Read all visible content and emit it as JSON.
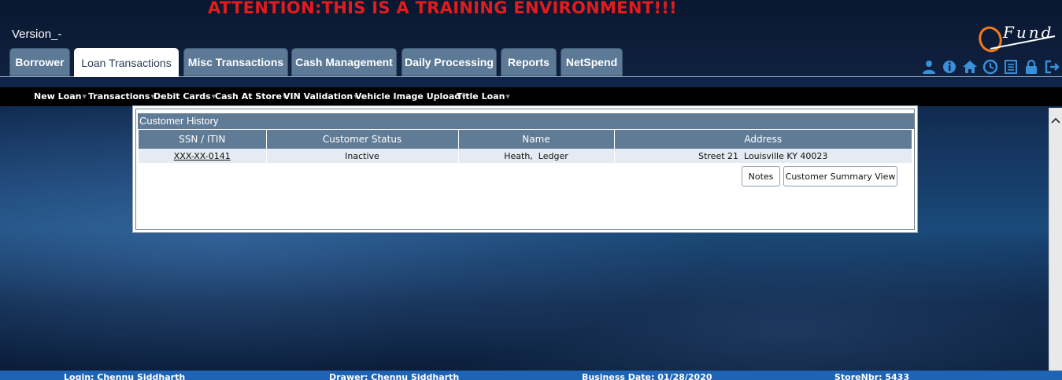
{
  "header": {
    "attention": "ATTENTION:THIS IS A TRAINING ENVIRONMENT!!!",
    "version": "Version_-",
    "logo_text": "Fund"
  },
  "tabs": [
    {
      "label": "Borrower",
      "active": false
    },
    {
      "label": "Loan Transactions",
      "active": true
    },
    {
      "label": "Misc Transactions",
      "active": false
    },
    {
      "label": "Cash Management",
      "active": false
    },
    {
      "label": "Daily Processing",
      "active": false
    },
    {
      "label": "Reports",
      "active": false
    },
    {
      "label": "NetSpend",
      "active": false
    }
  ],
  "top_icons": [
    "user-icon",
    "info-icon",
    "home-icon",
    "clock-icon",
    "list-icon",
    "lock-icon",
    "logout-icon"
  ],
  "menubar": [
    "New Loan",
    "Transactions",
    "Debit Cards",
    "Cash At Store",
    "VIN Validation",
    "Vehicle Image Upload",
    "Title Loan"
  ],
  "customer_history": {
    "title": "Customer History",
    "columns": [
      "SSN / ITIN",
      "Customer Status",
      "Name",
      "Address"
    ],
    "rows": [
      {
        "ssn": "XXX-XX-0141",
        "status": "Inactive",
        "name": "Heath,  Ledger",
        "address": "Street 21  Louisville KY 40023"
      }
    ],
    "buttons": {
      "notes": "Notes",
      "summary": "Customer Summary View"
    }
  },
  "footer": {
    "login": "Login: Chennu Siddharth",
    "drawer": "Drawer: Chennu Siddharth",
    "business_date": "Business Date: 01/28/2020",
    "store": "StoreNbr: 5433"
  },
  "colors": {
    "attention": "#e21c1c",
    "tab": "#5c7996",
    "grid_header": "#5f7b96",
    "footer": "#1f64b4"
  }
}
